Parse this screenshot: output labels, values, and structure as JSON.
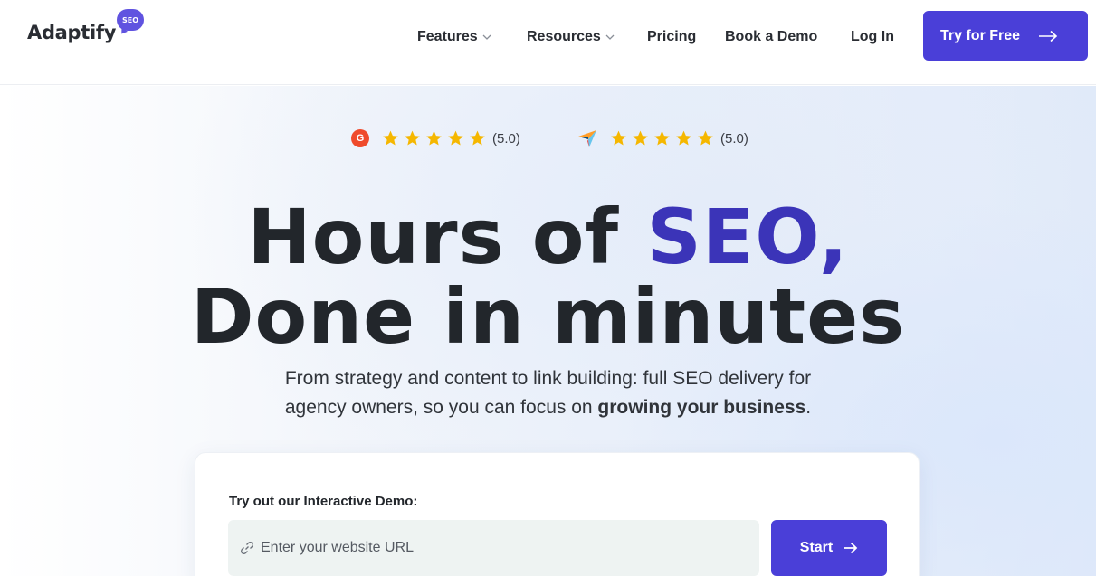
{
  "header": {
    "logo_text": "Adaptify",
    "logo_badge": "SEO",
    "nav": {
      "features": "Features",
      "resources": "Resources",
      "pricing": "Pricing",
      "book_demo": "Book a Demo",
      "login": "Log In"
    },
    "cta_label": "Try for Free"
  },
  "ratings": {
    "g2": {
      "icon": "g2-logo-icon",
      "badge": "G",
      "score": "(5.0)",
      "stars": 5
    },
    "capterra": {
      "icon": "capterra-logo-icon",
      "score": "(5.0)",
      "stars": 5
    }
  },
  "hero": {
    "title_line1_prefix": "Hours of ",
    "title_line1_accent": "SEO,",
    "title_line2": "Done in minutes",
    "subtitle_line1": "From strategy and content to link building: full SEO delivery for",
    "subtitle_line2_prefix": "agency owners, so you can focus on ",
    "subtitle_line2_bold": "growing your business",
    "subtitle_line2_suffix": "."
  },
  "demo": {
    "label": "Try out our Interactive Demo:",
    "url_placeholder": "Enter your website URL",
    "start_label": "Start"
  },
  "colors": {
    "brand": "#4a3fd8",
    "accent_text": "#3b34b8",
    "star": "#f5b700",
    "g2": "#ef4a2b"
  }
}
